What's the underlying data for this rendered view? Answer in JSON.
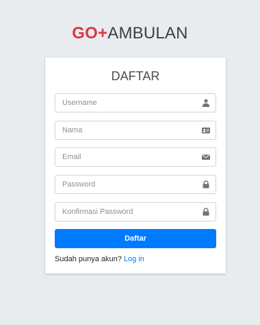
{
  "logo": {
    "strong": "GO+",
    "light": "AMBULAN"
  },
  "form": {
    "title": "DAFTAR",
    "fields": [
      {
        "placeholder": "Username",
        "icon": "user-icon"
      },
      {
        "placeholder": "Nama",
        "icon": "id-card-icon"
      },
      {
        "placeholder": "Email",
        "icon": "envelope-icon"
      },
      {
        "placeholder": "Password",
        "icon": "lock-icon"
      },
      {
        "placeholder": "Konfirmasi Password",
        "icon": "lock-icon"
      }
    ],
    "submit_label": "Daftar",
    "login_prompt": "Sudah punya akun?",
    "login_link": "Log in"
  },
  "colors": {
    "brand_red": "#dc3545",
    "primary": "#007bff",
    "background": "#e9ecef",
    "icon": "#6c757d"
  }
}
